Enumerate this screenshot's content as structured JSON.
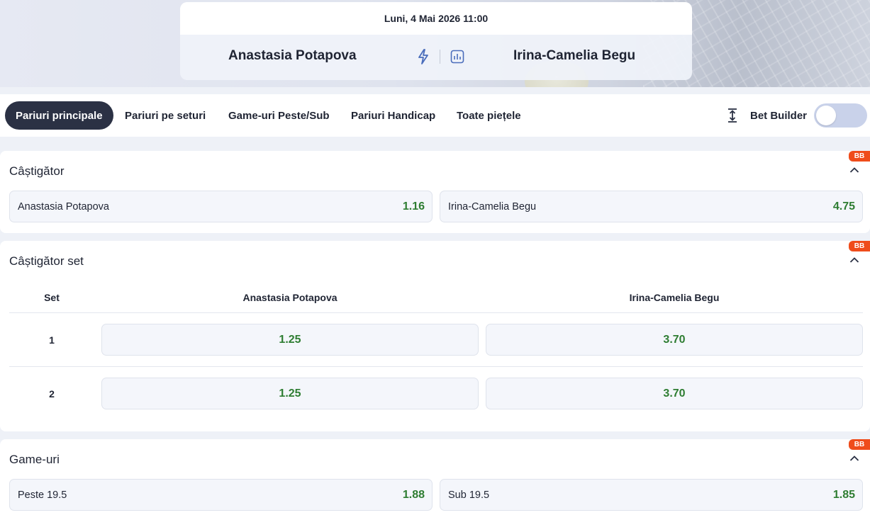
{
  "match": {
    "date": "Luni, 4 Mai 2026 11:00",
    "home": "Anastasia Potapova",
    "away": "Irina-Camelia Begu"
  },
  "tabs": [
    {
      "label": "Pariuri principale",
      "active": true
    },
    {
      "label": "Pariuri pe seturi",
      "active": false
    },
    {
      "label": "Game-uri Peste/Sub",
      "active": false
    },
    {
      "label": "Pariuri Handicap",
      "active": false
    },
    {
      "label": "Toate piețele",
      "active": false
    }
  ],
  "bet_builder": {
    "label": "Bet Builder",
    "enabled": false
  },
  "markets": {
    "winner": {
      "title": "Câștigător",
      "badge": "BB",
      "outcomes": [
        {
          "label": "Anastasia Potapova",
          "odd": "1.16"
        },
        {
          "label": "Irina-Camelia Begu",
          "odd": "4.75"
        }
      ]
    },
    "set_winner": {
      "title": "Câștigător set",
      "badge": "BB",
      "headers": {
        "set": "Set",
        "home": "Anastasia Potapova",
        "away": "Irina-Camelia Begu"
      },
      "rows": [
        {
          "set": "1",
          "home": "1.25",
          "away": "3.70"
        },
        {
          "set": "2",
          "home": "1.25",
          "away": "3.70"
        }
      ]
    },
    "games": {
      "title": "Game-uri",
      "badge": "BB",
      "outcomes": [
        {
          "label": "Peste 19.5",
          "odd": "1.88"
        },
        {
          "label": "Sub 19.5",
          "odd": "1.85"
        }
      ]
    }
  },
  "colors": {
    "odd": "#2e7d32",
    "active_tab": "#2b3144",
    "badge": "#ef4c1b"
  }
}
